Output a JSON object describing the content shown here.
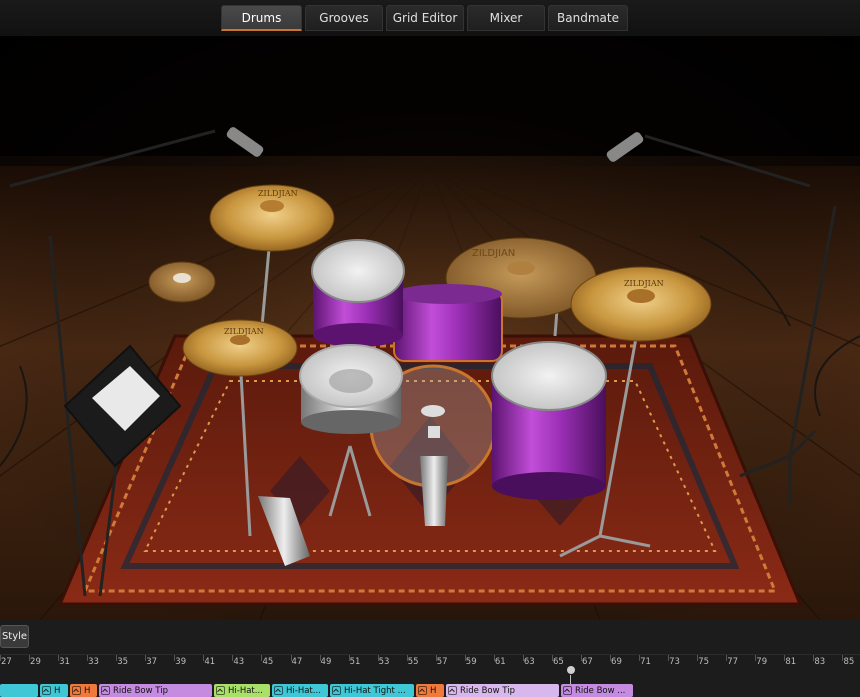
{
  "tabs": [
    {
      "label": "Drums",
      "active": true
    },
    {
      "label": "Grooves",
      "active": false
    },
    {
      "label": "Grid Editor",
      "active": false
    },
    {
      "label": "Mixer",
      "active": false
    },
    {
      "label": "Bandmate",
      "active": false
    }
  ],
  "stage": {
    "cymbal_labels": [
      "ZILDJIAN",
      "ZILDJIAN",
      "ZILDJIAN",
      "ZILDJIAN"
    ]
  },
  "bottom": {
    "style_button": "Style",
    "bar_numbers": [
      "27",
      "29",
      "31",
      "33",
      "35",
      "37",
      "39",
      "41",
      "43",
      "45",
      "47",
      "49",
      "51",
      "53",
      "55",
      "57",
      "59",
      "61",
      "63",
      "65",
      "67",
      "69",
      "71",
      "73",
      "75",
      "77",
      "79",
      "81",
      "83",
      "85"
    ],
    "clips": [
      {
        "label": "",
        "color": "#3fc7d6"
      },
      {
        "label": "H",
        "color": "#3fc7d6"
      },
      {
        "label": "H",
        "color": "#ef7a3c"
      },
      {
        "label": "Ride Bow Tip",
        "color": "#c58be0"
      },
      {
        "label": "Hi-Hat...",
        "color": "#a9e06a"
      },
      {
        "label": "Hi-Hat...",
        "color": "#3fc7d6"
      },
      {
        "label": "Hi-Hat Tight ...",
        "color": "#3fc7d6"
      },
      {
        "label": "H",
        "color": "#ef7a3c"
      },
      {
        "label": "Ride Bow Tip",
        "color": "#d8b7ec"
      },
      {
        "label": "Ride Bow ...",
        "color": "#c58be0"
      }
    ]
  },
  "colors": {
    "accent": "#c9752e",
    "shell": "#9b2fb5",
    "floor": "#5a3218",
    "rug": "#8a2a16"
  }
}
